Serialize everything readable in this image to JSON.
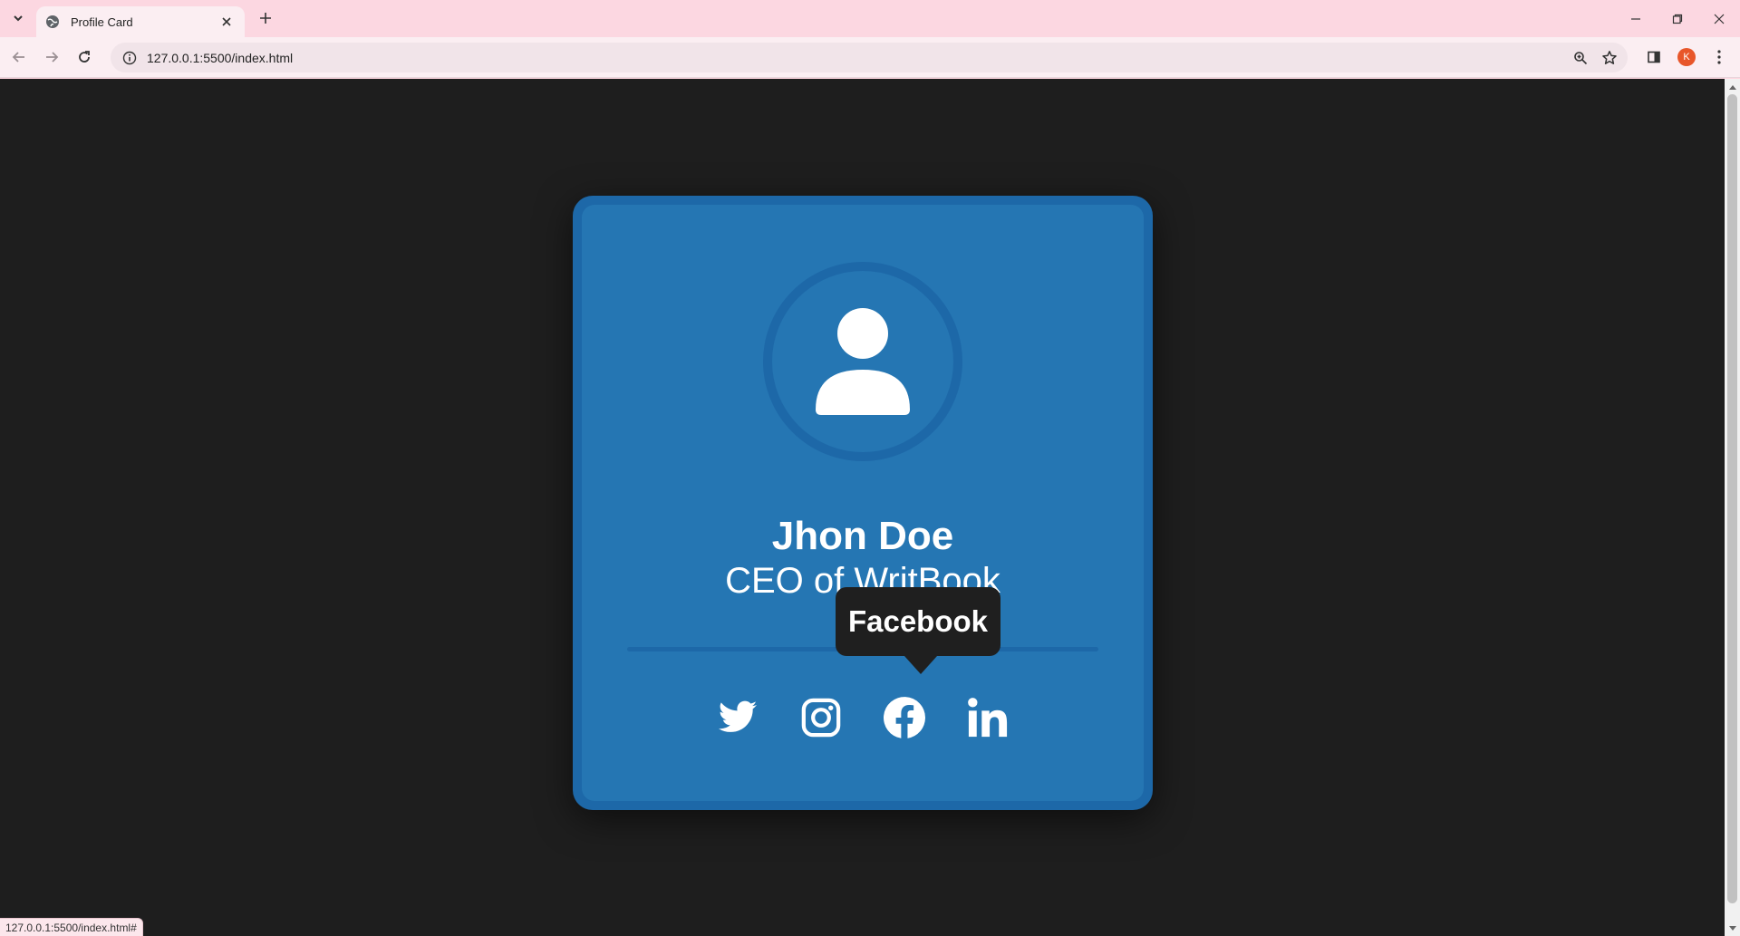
{
  "browser": {
    "tab_title": "Profile Card",
    "url": "127.0.0.1:5500/index.html",
    "avatar_letter": "K",
    "status_url": "127.0.0.1:5500/index.html#"
  },
  "profile": {
    "name": "Jhon Doe",
    "title": "CEO of WritBook",
    "social": [
      {
        "name": "twitter-icon",
        "label": "Twitter"
      },
      {
        "name": "instagram-icon",
        "label": "Instagram"
      },
      {
        "name": "facebook-icon",
        "label": "Facebook"
      },
      {
        "name": "linkedin-icon",
        "label": "LinkedIn"
      }
    ],
    "tooltip": "Facebook"
  },
  "colors": {
    "page_background": "#1e1e1e",
    "card_background": "#2576b3",
    "card_border": "#1d68a8",
    "tooltip_background": "#1f1f1f",
    "browser_frame": "#fcd7e1"
  }
}
